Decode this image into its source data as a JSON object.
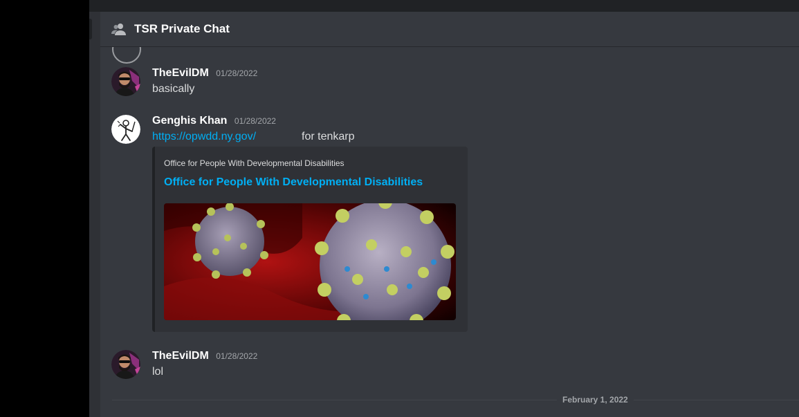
{
  "channel": {
    "title": "TSR Private Chat",
    "icon": "dm-group-icon"
  },
  "messages": [
    {
      "author": "TheEvilDM",
      "timestamp": "01/28/2022",
      "text": "basically",
      "avatar": "evil-dm-avatar"
    },
    {
      "author": "Genghis Khan",
      "timestamp": "01/28/2022",
      "link": "https://opwdd.ny.gov/",
      "text_after_link": "for tenkarp",
      "avatar": "genghis-avatar",
      "embed": {
        "provider": "Office for People With Developmental Disabilities",
        "title": "Office for People With Developmental Disabilities",
        "image": "virus-image"
      }
    },
    {
      "author": "TheEvilDM",
      "timestamp": "01/28/2022",
      "text": "lol",
      "avatar": "evil-dm-avatar"
    }
  ],
  "date_divider": "February 1, 2022",
  "colors": {
    "background": "#36393f",
    "link": "#00aff4",
    "embed_bg": "#2f3136"
  }
}
